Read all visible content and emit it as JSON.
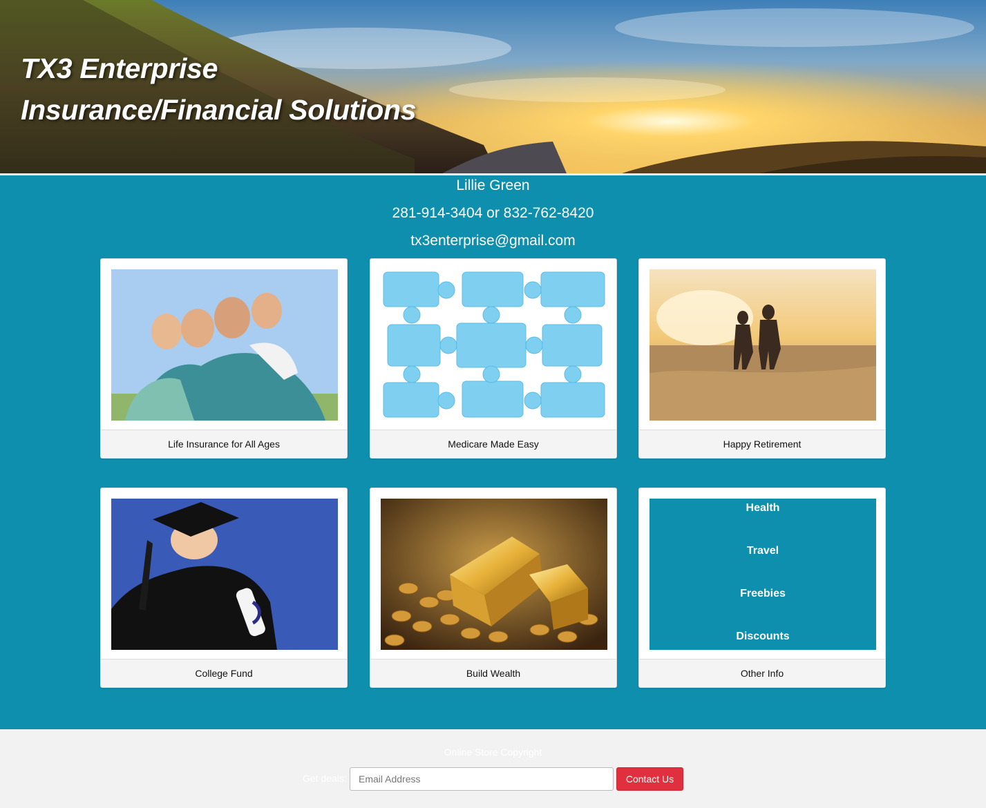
{
  "hero": {
    "title_line1": "TX3 Enterprise",
    "title_line2": "Insurance/Financial Solutions"
  },
  "contact": {
    "name": "Lillie Green",
    "phones": "281-914-3404 or 832-762-8420",
    "email": "tx3enterprise@gmail.com"
  },
  "cards": [
    {
      "caption": "Life Insurance for All Ages",
      "image": "family-photo"
    },
    {
      "caption": "Medicare Made Easy",
      "image": "puzzle-pieces"
    },
    {
      "caption": "Happy Retirement",
      "image": "beach-couple"
    },
    {
      "caption": "College Fund",
      "image": "graduate-photo"
    },
    {
      "caption": "Build Wealth",
      "image": "gold-bars-coins"
    },
    {
      "caption": "Other Info",
      "links": [
        "Health",
        "Travel",
        "Freebies",
        "Discounts"
      ]
    }
  ],
  "footer": {
    "copyright": "Online Store Copyright",
    "deals_label": "Get deals:",
    "email_placeholder": "Email Address",
    "contact_button": "Contact Us"
  },
  "colors": {
    "teal": "#0e8fae",
    "contact_button": "#e0303f",
    "footer_bg": "#f2f2f2"
  }
}
